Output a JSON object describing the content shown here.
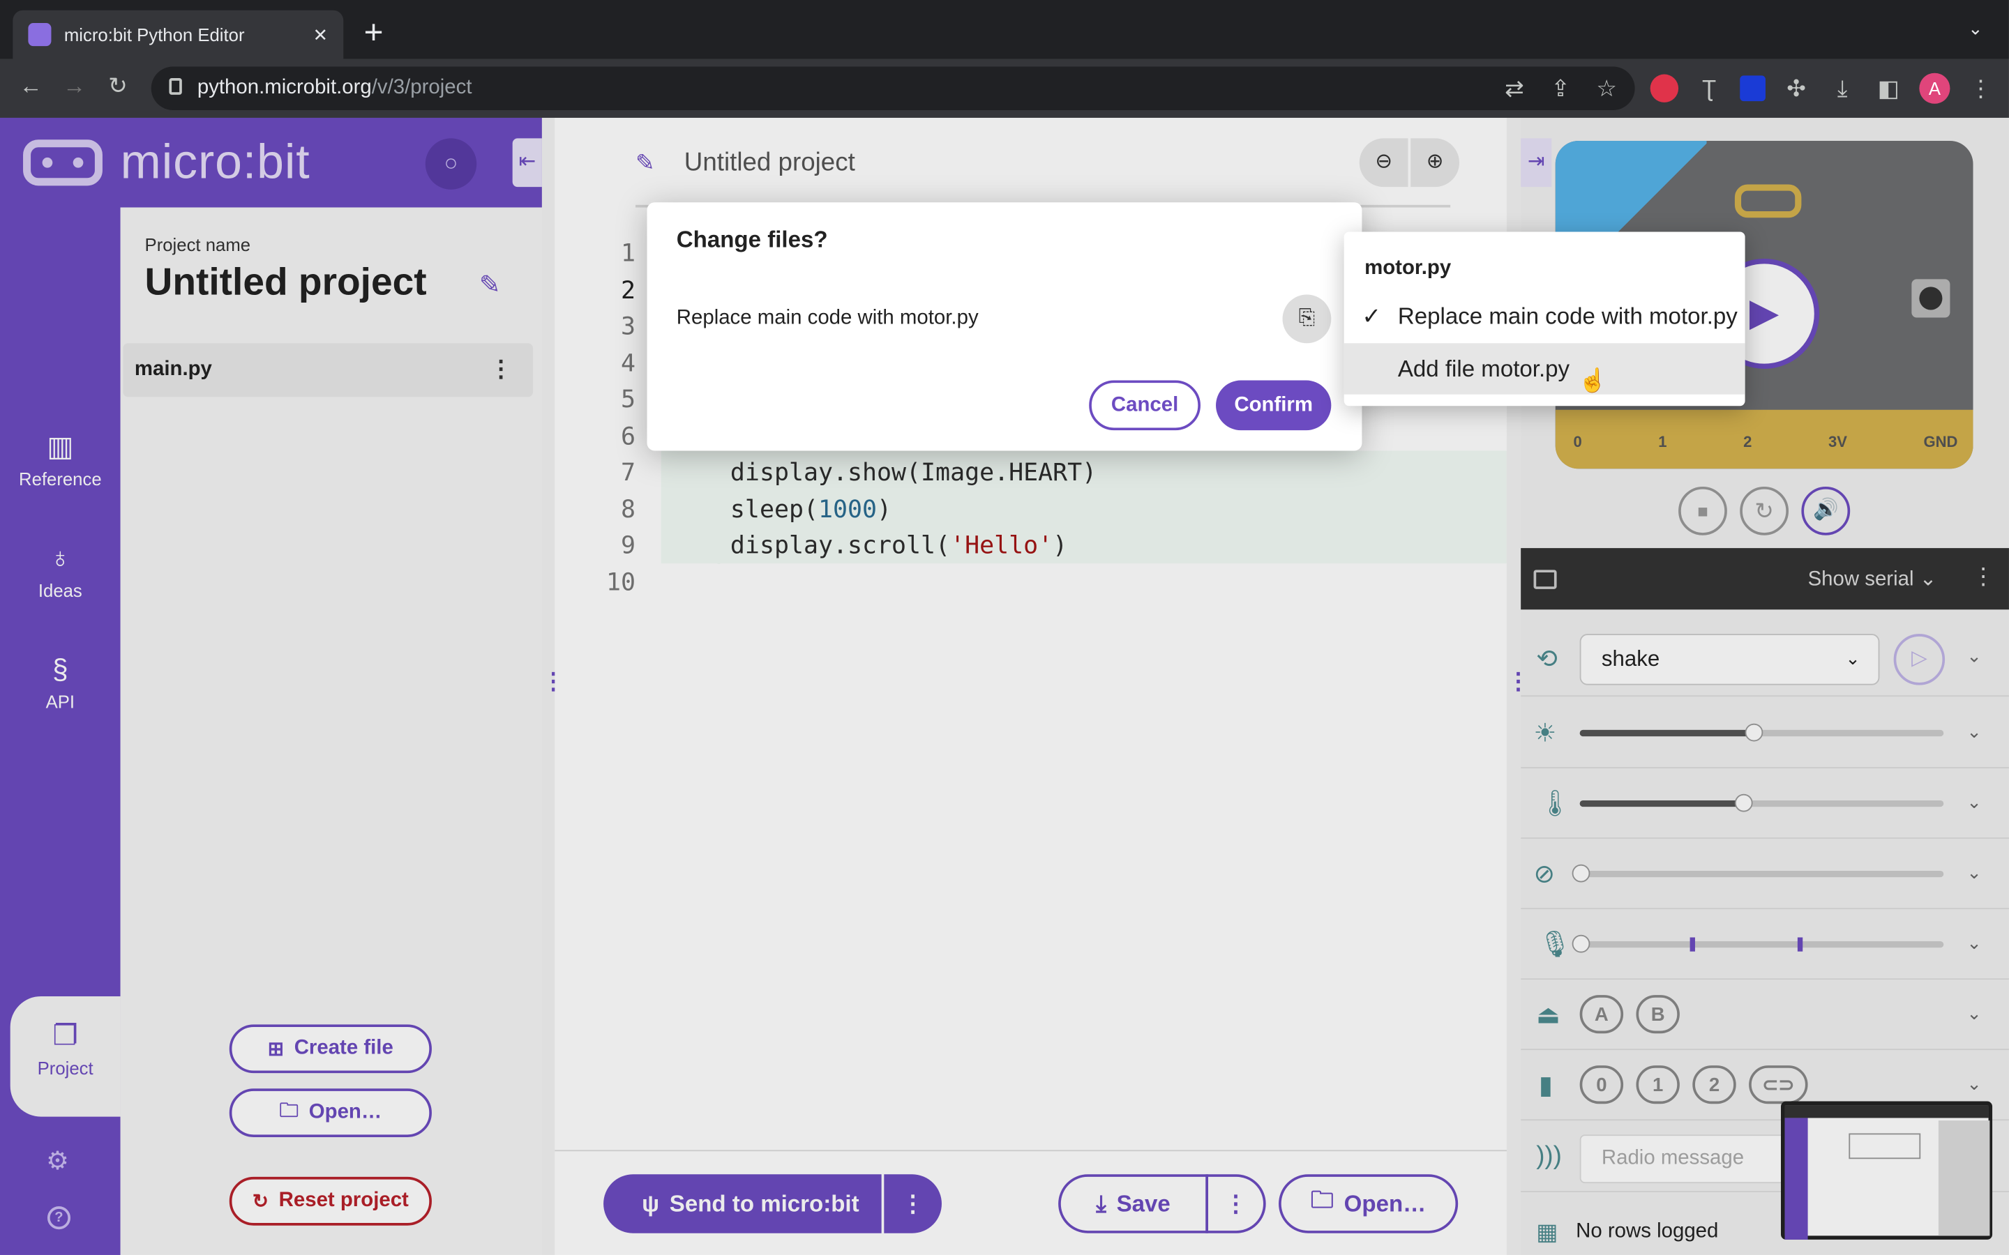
{
  "browser": {
    "tab_title": "micro:bit Python Editor",
    "url_host": "python.microbit.org",
    "url_path": "/v/3/project",
    "new_tab": "+",
    "close_tab": "✕",
    "profile": "A"
  },
  "app": {
    "logo": "micro:bit"
  },
  "nav": {
    "reference": "Reference",
    "ideas": "Ideas",
    "api": "API",
    "project": "Project"
  },
  "sidebar": {
    "project_name_label": "Project name",
    "project_name": "Untitled project",
    "file": "main.py",
    "create_file": "Create file",
    "open": "Open…",
    "reset": "Reset project"
  },
  "editor": {
    "title": "Untitled project",
    "line_numbers": [
      "1",
      "2",
      "3",
      "4",
      "5",
      "6",
      "7",
      "8",
      "9",
      "10"
    ],
    "lines": [
      {
        "pre": "display.show(Image.HEART)",
        "num": "",
        "str": "",
        "post": ""
      },
      {
        "pre": "sleep(",
        "num": "1000",
        "str": "",
        "post": ")"
      },
      {
        "pre": "display.scroll(",
        "num": "",
        "str": "'Hello'",
        "post": ")"
      }
    ]
  },
  "bottom": {
    "send": "Send to micro:bit",
    "save": "Save",
    "open": "Open…"
  },
  "dialog": {
    "title": "Change files?",
    "row": "Replace main code with motor.py",
    "cancel": "Cancel",
    "confirm": "Confirm"
  },
  "menu": {
    "header": "motor.py",
    "option1": "Replace main code with motor.py",
    "option2": "Add file motor.py"
  },
  "sim": {
    "pins": [
      "0",
      "1",
      "2",
      "3V",
      "GND"
    ],
    "serial": "Show serial",
    "gesture": "shake",
    "buttons": [
      "A",
      "B"
    ],
    "touch_pins": [
      "0",
      "1",
      "2"
    ],
    "radio_placeholder": "Radio message",
    "log": "No rows logged",
    "light_level": 0.48,
    "temperature_level": 0.45,
    "colors": {
      "accent": "#6c4bc1",
      "board": "#6d6e70",
      "gold": "#d5b24e",
      "danger": "#b8212b"
    }
  }
}
